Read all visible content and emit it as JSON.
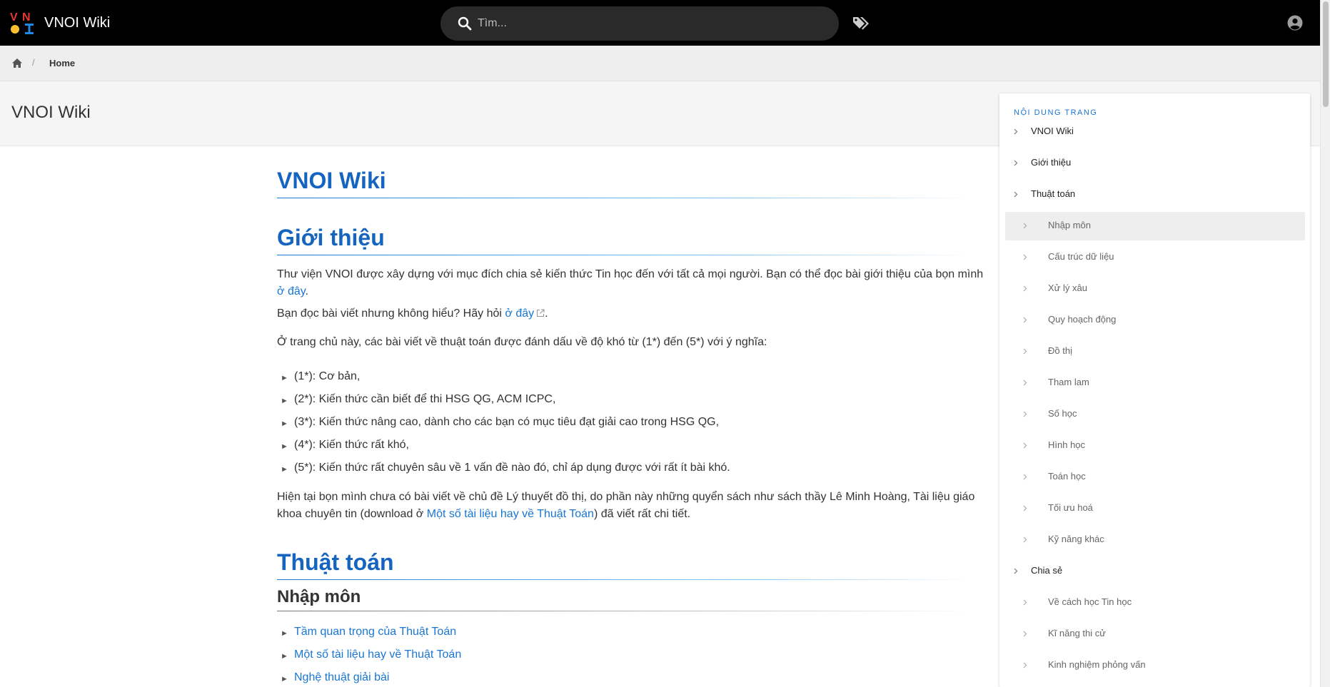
{
  "header": {
    "app_title": "VNOI Wiki",
    "logo_letters": "VNOI",
    "search_placeholder": "Tìm...",
    "icons": [
      "vnoi-logo-icon",
      "search-icon",
      "tags-icon",
      "account-circle-icon"
    ]
  },
  "breadcrumb": {
    "separator": "/",
    "current": "Home"
  },
  "page_title": "VNOI Wiki",
  "article": {
    "h1_main": "VNOI Wiki",
    "h1_intro": "Giới thiệu",
    "intro_para_text": "Thư viện VNOI được xây dựng với mục đích chia sẻ kiến thức Tin học đến với tất cả mọi người. Bạn có thể đọc bài giới thiệu của bọn mình ",
    "intro_para_link": "ở đây",
    "intro_para_end": ".",
    "ask_text": "Bạn đọc bài viết nhưng không hiểu? Hãy hỏi ",
    "ask_link": "ở đây",
    "ask_end": ".",
    "difficulty_intro": "Ở trang chủ này, các bài viết về thuật toán được đánh dấu về độ khó từ (1*) đến (5*) với ý nghĩa:",
    "difficulty_items": [
      "(1*): Cơ bản,",
      "(2*): Kiến thức cần biết để thi HSG QG, ACM ICPC,",
      "(3*): Kiến thức nâng cao, dành cho các bạn có mục tiêu đạt giải cao trong HSG QG,",
      "(4*): Kiến thức rất khó,",
      "(5*): Kiến thức rất chuyên sâu về 1 vấn đề nào đó, chỉ áp dụng được với rất ít bài khó."
    ],
    "graph_note_text": "Hiện tại bọn mình chưa có bài viết về chủ đề Lý thuyết đồ thị, do phần này những quyển sách như sách thầy Lê Minh Hoàng, Tài liệu giáo khoa chuyên tin (download ở ",
    "graph_note_link": "Một số tài liệu hay về Thuật Toán",
    "graph_note_end": ") đã viết rất chi tiết.",
    "h1_algo": "Thuật toán",
    "h2_intro": "Nhập môn",
    "intro_links": [
      "Tầm quan trọng của Thuật Toán",
      "Một số tài liệu hay về Thuật Toán",
      "Nghệ thuật giải bài"
    ]
  },
  "toc": {
    "header": "NỘI DUNG TRANG",
    "items": [
      {
        "label": "VNOI Wiki",
        "level": 1
      },
      {
        "label": "Giới thiệu",
        "level": 1
      },
      {
        "label": "Thuật toán",
        "level": 1
      },
      {
        "label": "Nhập môn",
        "level": 2,
        "active": true
      },
      {
        "label": "Cấu trúc dữ liệu",
        "level": 2
      },
      {
        "label": "Xử lý xâu",
        "level": 2
      },
      {
        "label": "Quy hoạch động",
        "level": 2
      },
      {
        "label": "Đồ thị",
        "level": 2
      },
      {
        "label": "Tham lam",
        "level": 2
      },
      {
        "label": "Số học",
        "level": 2
      },
      {
        "label": "Hình học",
        "level": 2
      },
      {
        "label": "Toán học",
        "level": 2
      },
      {
        "label": "Tối ưu hoá",
        "level": 2
      },
      {
        "label": "Kỹ năng khác",
        "level": 2
      },
      {
        "label": "Chia sẻ",
        "level": 1
      },
      {
        "label": "Về cách học Tin học",
        "level": 2
      },
      {
        "label": "Kĩ năng thi cử",
        "level": 2
      },
      {
        "label": "Kinh nghiệm phỏng vấn",
        "level": 2
      }
    ]
  },
  "colors": {
    "topbar_bg": "#000000",
    "link": "#1976d2",
    "heading": "#1565c0",
    "logo_red": "#e53935",
    "logo_blue": "#1e88e5",
    "logo_yellow": "#fbc02d"
  }
}
